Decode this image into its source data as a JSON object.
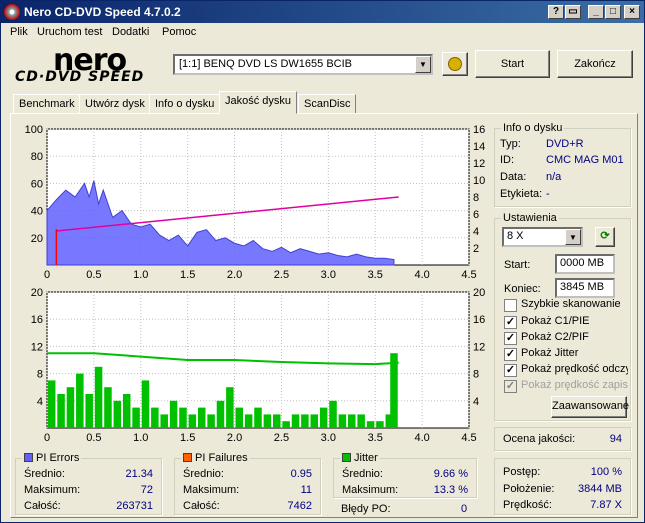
{
  "window": {
    "title": "Nero CD-DVD Speed 4.7.0.2"
  },
  "menu": [
    "Plik",
    "Uruchom test",
    "Dodatki",
    "Pomoc"
  ],
  "logo": {
    "top": "nero",
    "bottom": "CD·DVD SPEED"
  },
  "drive": {
    "selected": "[1:1]  BENQ DVD LS DW1655 BCIB"
  },
  "buttons": {
    "start": "Start",
    "exit": "Zakończ",
    "advanced": "Zaawansowane"
  },
  "tabs": [
    "Benchmark",
    "Utwórz dysk",
    "Info o dysku",
    "Jakość dysku",
    "ScanDisc"
  ],
  "disc_info": {
    "title": "Info o dysku",
    "rows": [
      {
        "label": "Typ:",
        "value": "DVD+R"
      },
      {
        "label": "ID:",
        "value": "CMC MAG M01"
      },
      {
        "label": "Data:",
        "value": "n/a"
      },
      {
        "label": "Etykieta:",
        "value": "-"
      }
    ]
  },
  "settings": {
    "title": "Ustawienia",
    "speed": "8 X",
    "start_label": "Start:",
    "start_value": "0000 MB",
    "end_label": "Koniec:",
    "end_value": "3845 MB",
    "checks": [
      {
        "label": "Szybkie skanowanie",
        "checked": false,
        "disabled": false
      },
      {
        "label": "Pokaż C1/PIE",
        "checked": true,
        "disabled": false
      },
      {
        "label": "Pokaż C2/PIF",
        "checked": true,
        "disabled": false
      },
      {
        "label": "Pokaż Jitter",
        "checked": true,
        "disabled": false
      },
      {
        "label": "Pokaż prędkość odczytu",
        "checked": true,
        "disabled": false
      },
      {
        "label": "Pokaż prędkość zapisu",
        "checked": true,
        "disabled": true
      }
    ]
  },
  "quality": {
    "label": "Ocena jakości:",
    "value": "94"
  },
  "pi_errors": {
    "title": "PI Errors",
    "color": "#6060ff",
    "rows": [
      {
        "label": "Średnio:",
        "value": "21.34"
      },
      {
        "label": "Maksimum:",
        "value": "72"
      },
      {
        "label": "Całość:",
        "value": "263731"
      }
    ]
  },
  "pi_failures": {
    "title": "PI Failures",
    "color": "#ff6000",
    "rows": [
      {
        "label": "Średnio:",
        "value": "0.95"
      },
      {
        "label": "Maksimum:",
        "value": "11"
      },
      {
        "label": "Całość:",
        "value": "7462"
      }
    ]
  },
  "jitter": {
    "title": "Jitter",
    "color": "#00c000",
    "rows": [
      {
        "label": "Średnio:",
        "value": "9.66 %"
      },
      {
        "label": "Maksimum:",
        "value": "13.3 %"
      }
    ]
  },
  "po_errors": {
    "label": "Błędy PO:",
    "value": "0"
  },
  "progress": {
    "rows": [
      {
        "label": "Postęp:",
        "value": "100 %"
      },
      {
        "label": "Położenie:",
        "value": "3844 MB"
      },
      {
        "label": "Prędkość:",
        "value": "7.87 X"
      }
    ]
  },
  "chart_data": [
    {
      "type": "area",
      "series": [
        {
          "name": "PI Errors",
          "color": "#6060ff",
          "x": [
            0,
            0.1,
            0.2,
            0.3,
            0.4,
            0.45,
            0.5,
            0.55,
            0.6,
            0.7,
            0.8,
            0.9,
            1.0,
            1.1,
            1.2,
            1.3,
            1.4,
            1.5,
            1.6,
            1.7,
            1.8,
            1.9,
            2.0,
            2.1,
            2.2,
            2.3,
            2.4,
            2.5,
            2.6,
            2.7,
            2.8,
            2.9,
            3.0,
            3.1,
            3.2,
            3.3,
            3.4,
            3.5,
            3.6,
            3.7
          ],
          "y": [
            40,
            48,
            55,
            50,
            60,
            50,
            62,
            45,
            55,
            35,
            40,
            30,
            28,
            30,
            22,
            18,
            22,
            14,
            24,
            26,
            18,
            20,
            16,
            14,
            18,
            12,
            10,
            13,
            9,
            12,
            10,
            8,
            9,
            7,
            6,
            8,
            6,
            5,
            5,
            4
          ]
        },
        {
          "name": "Read speed",
          "color": "#e000a0",
          "x": [
            0.1,
            3.75
          ],
          "y": [
            4,
            8
          ]
        }
      ],
      "x_ticks": [
        "0",
        "0.5",
        "1.0",
        "1.5",
        "2.0",
        "2.5",
        "3.0",
        "3.5",
        "4.0",
        "4.5"
      ],
      "y_left_ticks": [
        "20",
        "40",
        "60",
        "80",
        "100"
      ],
      "y_right_ticks": [
        "2",
        "4",
        "6",
        "8",
        "10",
        "12",
        "14",
        "16"
      ],
      "xlim": [
        0,
        4.5
      ],
      "ylim": [
        0,
        100
      ],
      "y2lim": [
        0,
        16
      ],
      "grid": true
    },
    {
      "type": "bar",
      "series": [
        {
          "name": "PI Failures",
          "color": "#00c000",
          "x": [
            0.05,
            0.15,
            0.25,
            0.35,
            0.45,
            0.55,
            0.65,
            0.75,
            0.85,
            0.95,
            1.05,
            1.15,
            1.25,
            1.35,
            1.45,
            1.55,
            1.65,
            1.75,
            1.85,
            1.95,
            2.05,
            2.15,
            2.25,
            2.35,
            2.45,
            2.55,
            2.65,
            2.75,
            2.85,
            2.95,
            3.05,
            3.15,
            3.25,
            3.35,
            3.45,
            3.55,
            3.65,
            3.7
          ],
          "y": [
            7,
            5,
            6,
            8,
            5,
            9,
            6,
            4,
            5,
            3,
            7,
            3,
            2,
            4,
            3,
            2,
            3,
            2,
            4,
            6,
            3,
            2,
            3,
            2,
            2,
            1,
            2,
            2,
            2,
            3,
            4,
            2,
            2,
            2,
            1,
            1,
            2,
            11
          ]
        },
        {
          "name": "Jitter",
          "color": "#00c000",
          "x": [
            0,
            0.5,
            1.0,
            1.5,
            2.0,
            2.5,
            3.0,
            3.5,
            3.75
          ],
          "y": [
            11,
            11,
            10.5,
            10,
            10,
            9.7,
            9.5,
            9.4,
            9.6
          ]
        }
      ],
      "x_ticks": [
        "0",
        "0.5",
        "1.0",
        "1.5",
        "2.0",
        "2.5",
        "3.0",
        "3.5",
        "4.0",
        "4.5"
      ],
      "y_left_ticks": [
        "4",
        "8",
        "12",
        "16",
        "20"
      ],
      "y_right_ticks": [
        "4",
        "8",
        "12",
        "16",
        "20"
      ],
      "xlim": [
        0,
        4.5
      ],
      "ylim": [
        0,
        20
      ],
      "y2lim": [
        0,
        20
      ],
      "grid": true
    }
  ]
}
